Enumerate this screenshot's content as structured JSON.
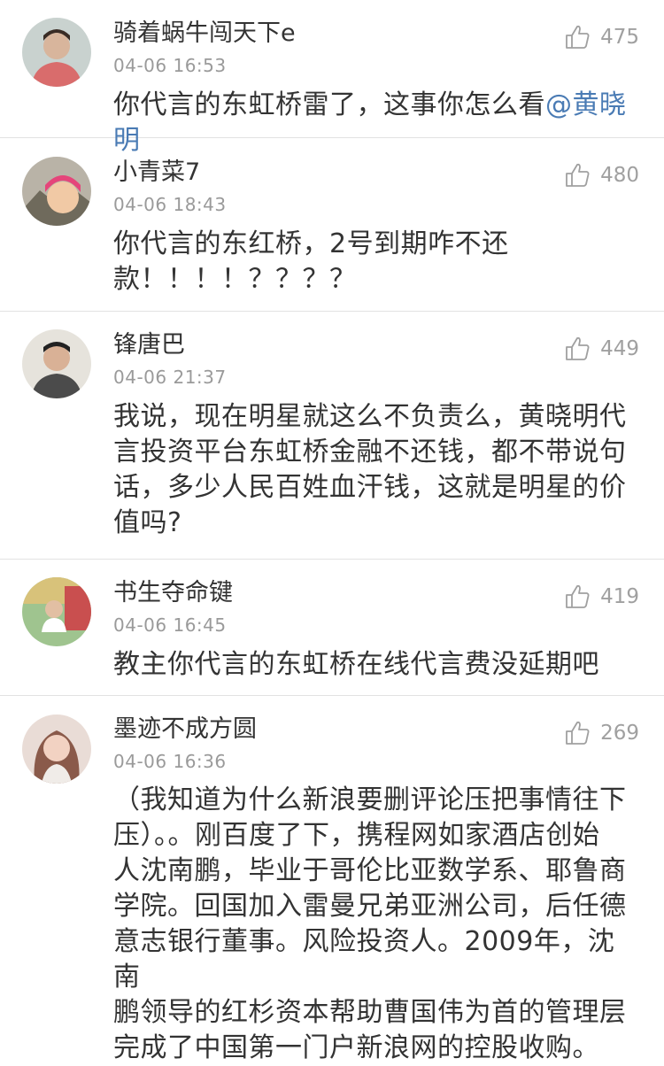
{
  "comments": [
    {
      "username": "骑着蜗牛闯天下e",
      "time": "04-06 16:53",
      "likes": "475",
      "text": "你代言的东虹桥雷了，这事你怎么看",
      "mention": "@黄晓明",
      "avatar_color": "#d96c6c"
    },
    {
      "username": "小青菜7",
      "time": "04-06 18:43",
      "likes": "480",
      "text": "你代言的东红桥，2号到期咋不还\n款！！！！？？？？",
      "mention": "",
      "avatar_color": "#e5457a"
    },
    {
      "username": "锋唐巴",
      "time": "04-06 21:37",
      "likes": "449",
      "text": "我说，现在明星就这么不负责么，黄晓明代\n言投资平台东虹桥金融不还钱，都不带说句\n话，多少人民百姓血汗钱，这就是明星的价\n值吗?",
      "mention": "",
      "avatar_color": "#4b4b4b"
    },
    {
      "username": "书生夺命键",
      "time": "04-06 16:45",
      "likes": "419",
      "text": "教主你代言的东虹桥在线代言费没延期吧",
      "mention": "",
      "avatar_color": "#6fa36a"
    },
    {
      "username": "墨迹不成方圆",
      "time": "04-06 16:36",
      "likes": "269",
      "text": "（我知道为什么新浪要删评论压把事情往下\n压）。。刚百度了下，携程网如家酒店创始\n人沈南鹏，毕业于哥伦比亚数学系、耶鲁商\n学院。回国加入雷曼兄弟亚洲公司，后任德\n意志银行董事。风险投资人。2009年，沈南\n鹏领导的红杉资本帮助曹国伟为首的管理层\n完成了中国第一门户新浪网的控股收购。",
      "mention": "",
      "avatar_color": "#c98f86"
    }
  ],
  "icons": {
    "like": "thumbs-up-icon"
  },
  "colors": {
    "mention": "#4a7bb4",
    "meta": "#9a9a9a",
    "divider": "#e2e2e2"
  }
}
